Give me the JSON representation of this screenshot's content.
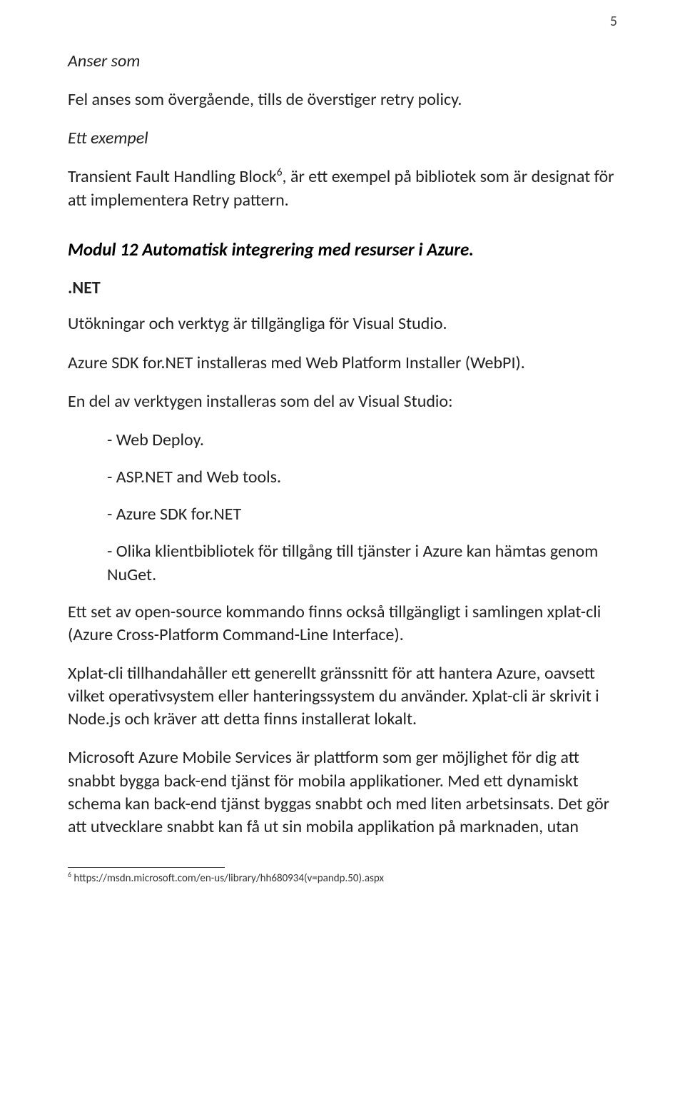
{
  "page_number": "5",
  "anser_som_label": "Anser som",
  "p_fel": "Fel anses som övergående, tills de överstiger retry policy.",
  "ett_exempel_label": "Ett exempel",
  "p_transient_pre": "Transient Fault Handling Block",
  "p_transient_sup": "6",
  "p_transient_post": ", är ett exempel på bibliotek som är designat för att implementera Retry pattern.",
  "heading_modul12": "Modul 12 Automatisk integrering med resurser i Azure.",
  "sub_net": ".NET",
  "p_utokningar": "Utökningar och verktyg är tillgängliga för Visual Studio.",
  "p_sdk": "Azure SDK for.NET installeras med Web Platform Installer (WebPI).",
  "p_endel": "En del av verktygen installeras som del av Visual Studio:",
  "li1": "- Web Deploy.",
  "li2": "- ASP.NET and Web tools.",
  "li3": "- Azure SDK for.NET",
  "li4": "- Olika klientbibliotek för tillgång till tjänster i Azure kan hämtas genom NuGet.",
  "p_xplat1": "Ett set av open-source kommando finns också tillgängligt i samlingen xplat-cli (Azure Cross-Platform Command-Line Interface).",
  "p_xplat2": "Xplat-cli tillhandahåller ett generellt gränssnitt för att hantera Azure, oavsett vilket operativsystem eller hanteringssystem du använder. Xplat-cli är skrivit i Node.js och kräver att detta finns installerat lokalt.",
  "p_mobile": "Microsoft Azure Mobile Services är plattform som ger möjlighet för dig att snabbt bygga back-end tjänst för mobila applikationer. Med ett dynamiskt schema kan back-end tjänst byggas snabbt och med liten arbetsinsats. Det gör att utvecklare snabbt kan få ut sin mobila applikation på marknaden, utan",
  "footnote_sup": "6",
  "footnote_text": " https://msdn.microsoft.com/en-us/library/hh680934(v=pandp.50).aspx"
}
